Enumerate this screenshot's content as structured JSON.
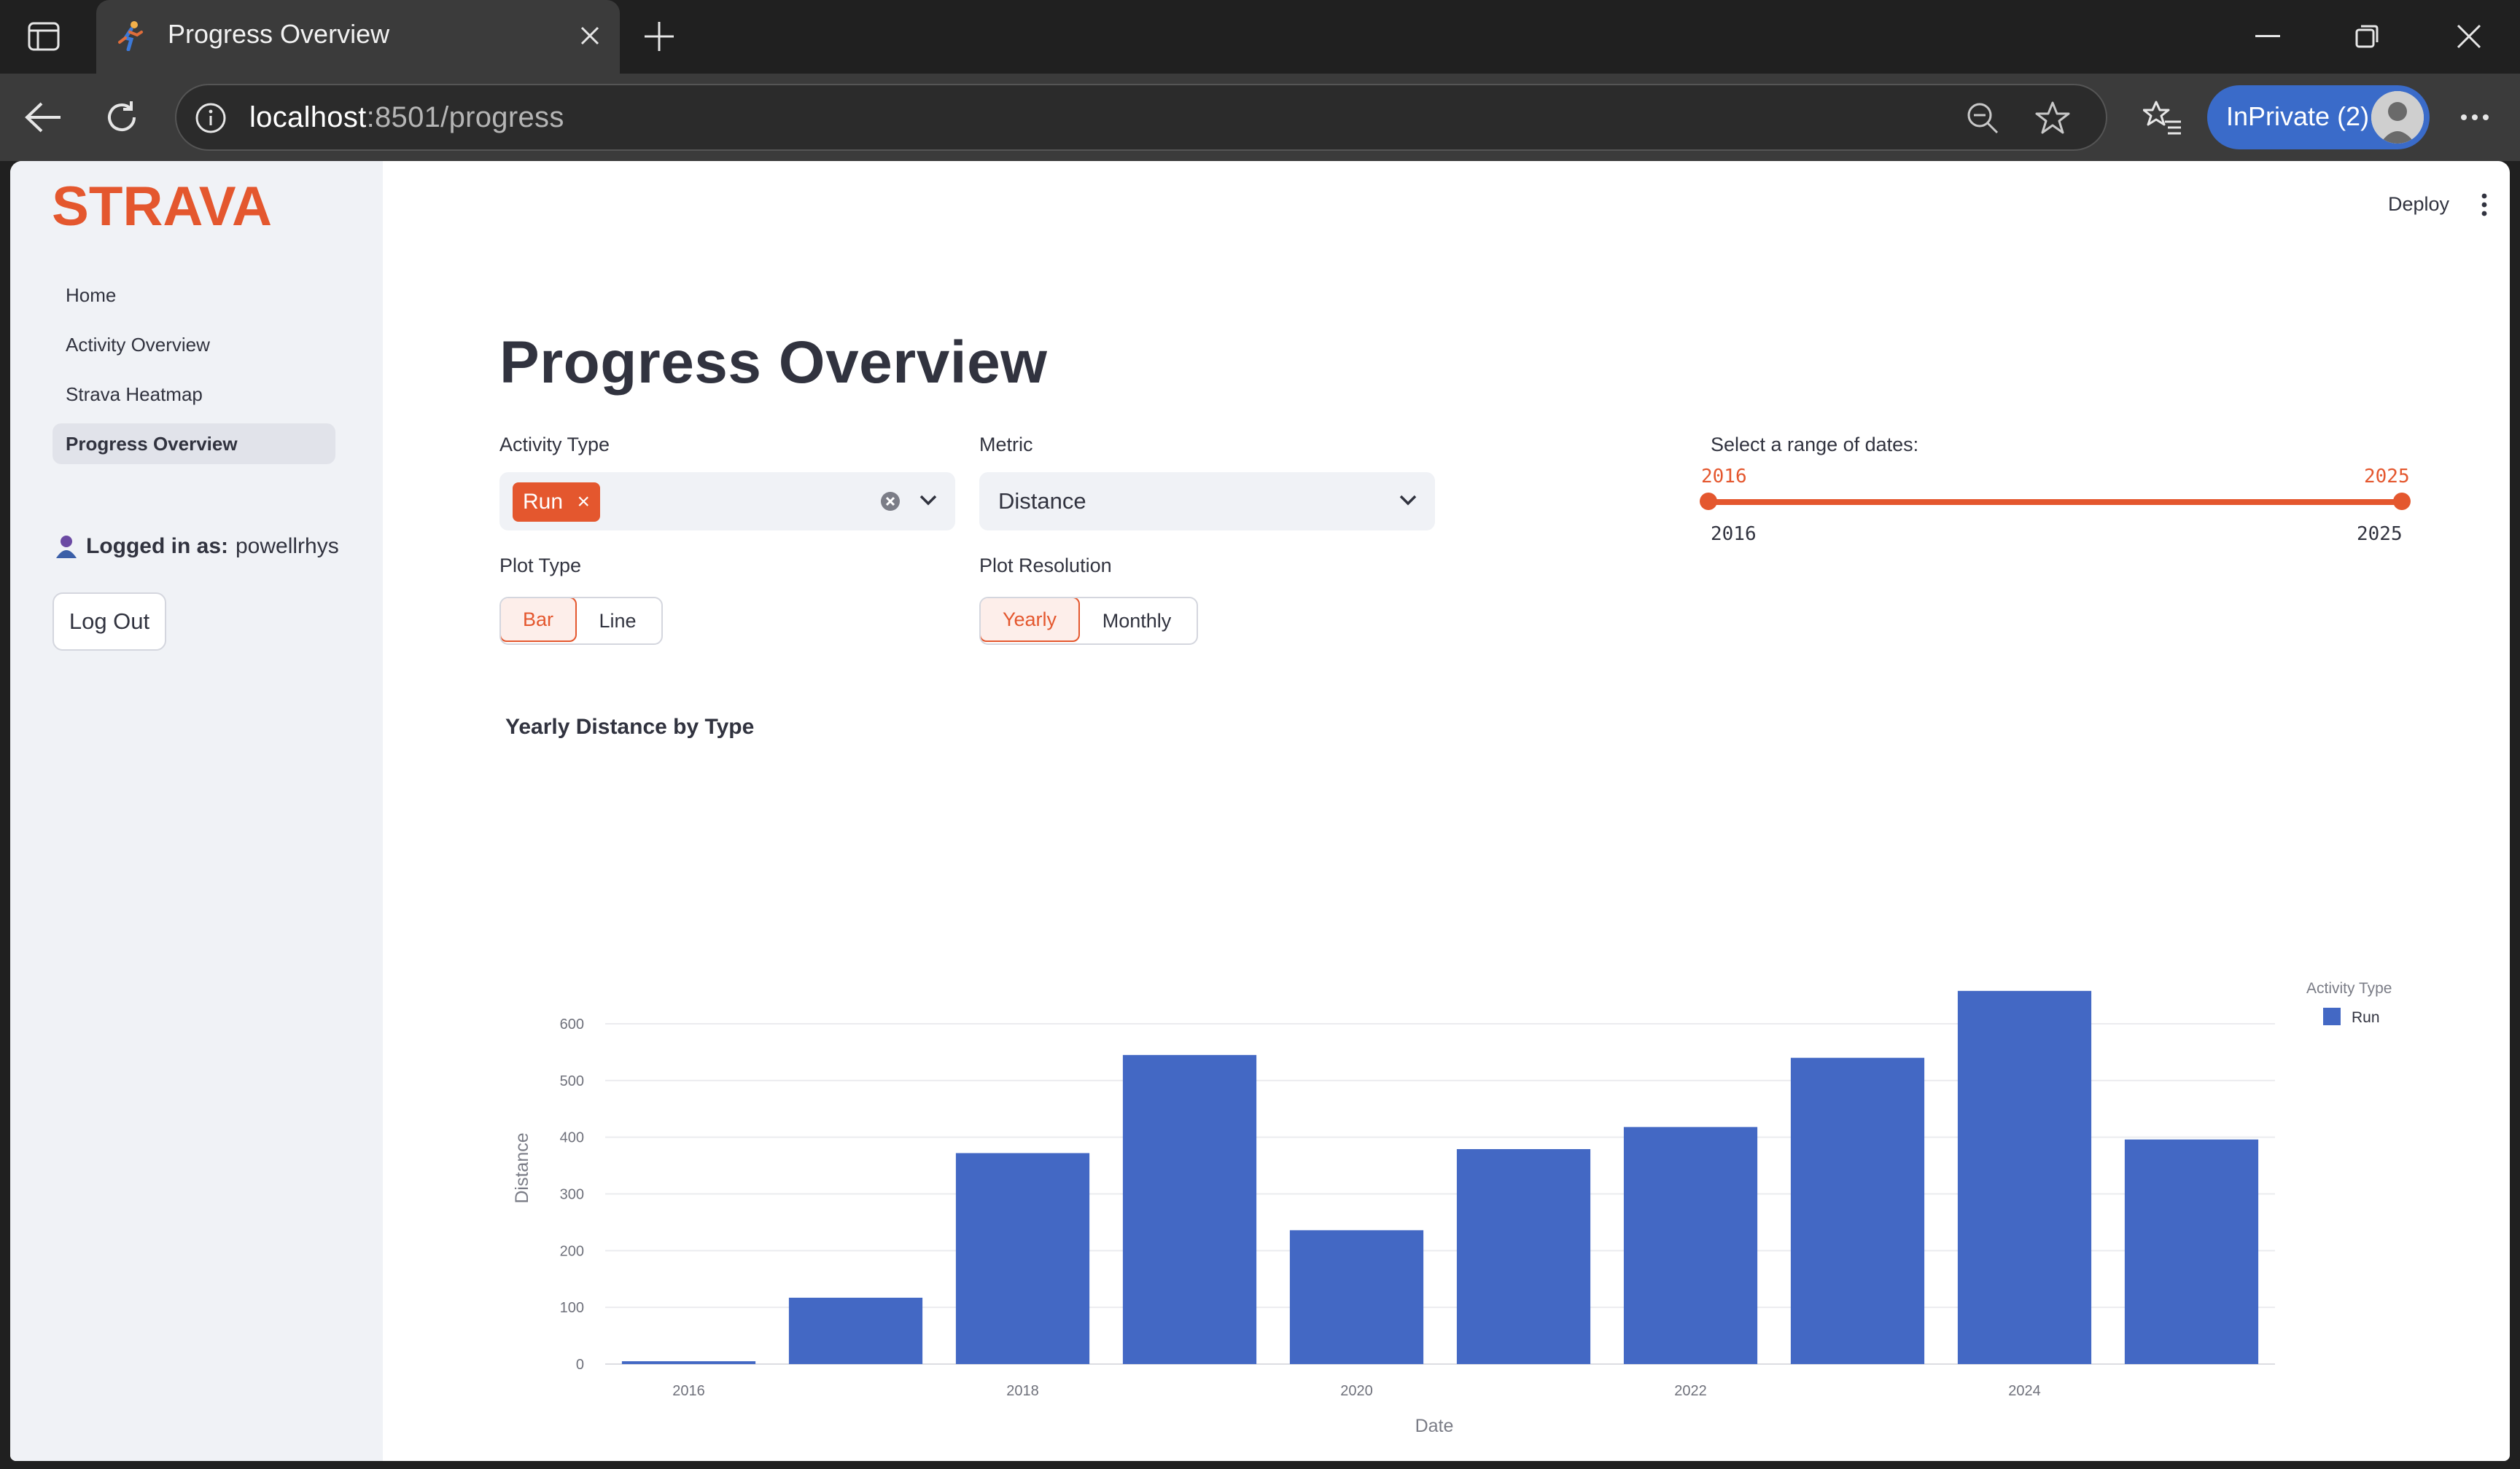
{
  "browser": {
    "tab_title": "Progress Overview",
    "url_host": "localhost",
    "url_path": ":8501/progress",
    "profile_label": "InPrivate (2)"
  },
  "sidebar": {
    "logo_text": "STRAVA",
    "nav": [
      {
        "label": "Home",
        "active": false
      },
      {
        "label": "Activity Overview",
        "active": false
      },
      {
        "label": "Strava Heatmap",
        "active": false
      },
      {
        "label": "Progress Overview",
        "active": true
      }
    ],
    "logged_prefix": "Logged in as:",
    "username": "powellrhys",
    "logout_label": "Log Out"
  },
  "header": {
    "deploy_label": "Deploy"
  },
  "page": {
    "title": "Progress Overview",
    "activity_type": {
      "label": "Activity Type",
      "chip": "Run"
    },
    "metric": {
      "label": "Metric",
      "value": "Distance"
    },
    "plot_type": {
      "label": "Plot Type",
      "options": [
        "Bar",
        "Line"
      ],
      "selected": "Bar"
    },
    "plot_resolution": {
      "label": "Plot Resolution",
      "options": [
        "Yearly",
        "Monthly"
      ],
      "selected": "Yearly"
    },
    "date_range": {
      "label": "Select a range of dates:",
      "value_start": "2016",
      "value_end": "2025",
      "min": "2016",
      "max": "2025"
    }
  },
  "colors": {
    "accent": "#e4572e",
    "bar": "#4368c4",
    "text": "#31333f",
    "sidebar_bg": "#f0f2f6"
  },
  "chart_data": {
    "type": "bar",
    "title": "Yearly Distance by Type",
    "xlabel": "Date",
    "ylabel": "Distance",
    "legend_title": "Activity Type",
    "legend_position": "top-right",
    "grid": true,
    "ylim": [
      0,
      660
    ],
    "yticks": [
      0,
      100,
      200,
      300,
      400,
      500,
      600
    ],
    "xticks": [
      "2016",
      "2018",
      "2020",
      "2022",
      "2024"
    ],
    "categories": [
      "2016",
      "2017",
      "2018",
      "2019",
      "2020",
      "2021",
      "2022",
      "2023",
      "2024",
      "2025"
    ],
    "series": [
      {
        "name": "Run",
        "values": [
          5,
          117,
          372,
          545,
          236,
          379,
          418,
          540,
          658,
          396
        ]
      }
    ]
  }
}
